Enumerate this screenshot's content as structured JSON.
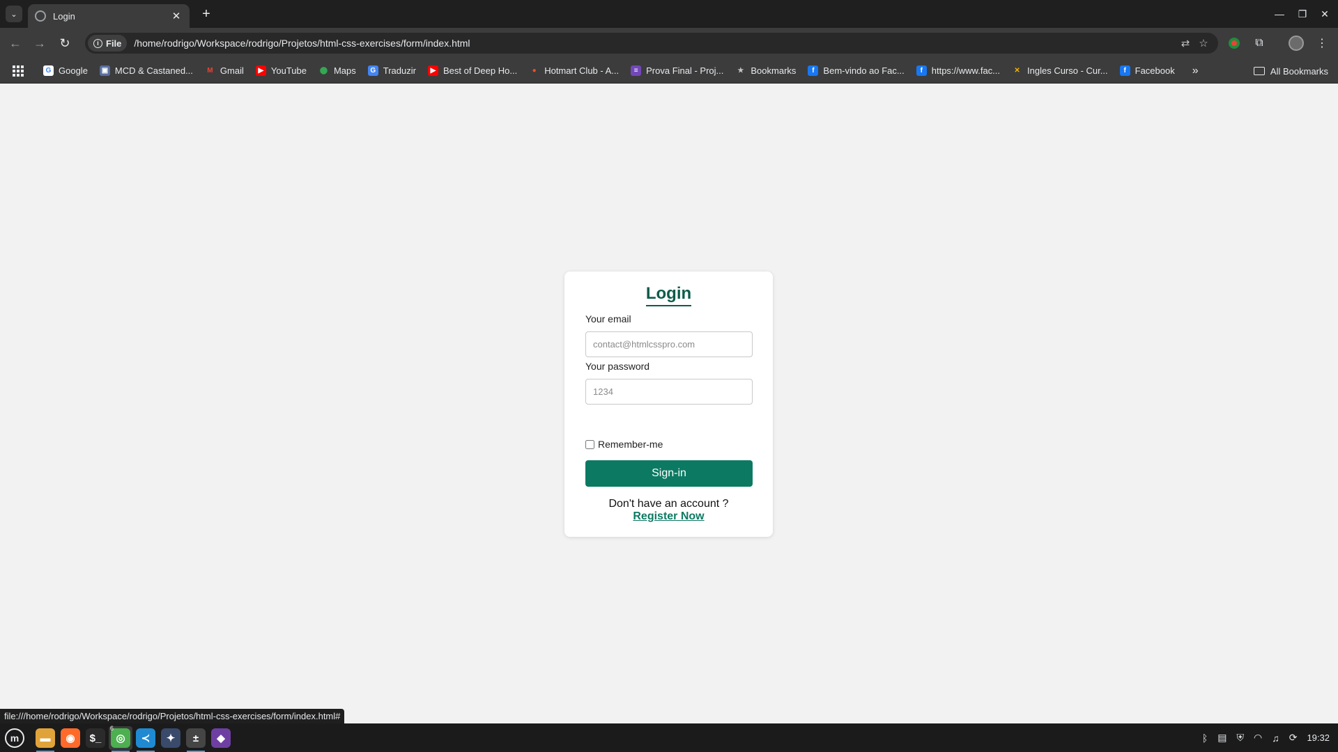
{
  "browser": {
    "tab_title": "Login",
    "url_chip": "File",
    "url": "/home/rodrigo/Workspace/rodrigo/Projetos/html-css-exercises/form/index.html",
    "status_url": "file:///home/rodrigo/Workspace/rodrigo/Projetos/html-css-exercises/form/index.html#"
  },
  "bookmarks": {
    "items": [
      {
        "label": "Google",
        "icon": "google-icon",
        "color": "#ffffff",
        "glyph": "G",
        "glyph_color": "#4285f4"
      },
      {
        "label": "MCD & Castaned...",
        "icon": "mcd-icon",
        "color": "#5a6f9e",
        "glyph": "▣",
        "glyph_color": "#ffffff"
      },
      {
        "label": "Gmail",
        "icon": "gmail-icon",
        "color": "#3c3c3c",
        "glyph": "M",
        "glyph_color": "#ea4335"
      },
      {
        "label": "YouTube",
        "icon": "youtube-icon",
        "color": "#ff0000",
        "glyph": "▶",
        "glyph_color": "#ffffff"
      },
      {
        "label": "Maps",
        "icon": "maps-icon",
        "color": "#3c3c3c",
        "glyph": "⬤",
        "glyph_color": "#34a853"
      },
      {
        "label": "Traduzir",
        "icon": "translate-icon",
        "color": "#4285f4",
        "glyph": "G",
        "glyph_color": "#ffffff"
      },
      {
        "label": "Best of Deep Ho...",
        "icon": "youtube-icon",
        "color": "#ff0000",
        "glyph": "▶",
        "glyph_color": "#ffffff"
      },
      {
        "label": "Hotmart Club - A...",
        "icon": "hotmart-icon",
        "color": "#3c3c3c",
        "glyph": "●",
        "glyph_color": "#f04e23"
      },
      {
        "label": "Prova Final - Proj...",
        "icon": "forms-icon",
        "color": "#7248b9",
        "glyph": "≡",
        "glyph_color": "#ffffff"
      },
      {
        "label": "Bookmarks",
        "icon": "star-icon",
        "color": "#3c3c3c",
        "glyph": "★",
        "glyph_color": "#c4c7c5"
      },
      {
        "label": "Bem-vindo ao Fac...",
        "icon": "facebook-icon",
        "color": "#1877f2",
        "glyph": "f",
        "glyph_color": "#ffffff"
      },
      {
        "label": "https://www.fac...",
        "icon": "facebook-icon",
        "color": "#1877f2",
        "glyph": "f",
        "glyph_color": "#ffffff"
      },
      {
        "label": "Ingles Curso - Cur...",
        "icon": "course-icon",
        "color": "#3c3c3c",
        "glyph": "✕",
        "glyph_color": "#f4b400"
      },
      {
        "label": "Facebook",
        "icon": "facebook-icon",
        "color": "#1877f2",
        "glyph": "f",
        "glyph_color": "#ffffff"
      }
    ],
    "overflow": "»",
    "all_bookmarks": "All Bookmarks"
  },
  "login": {
    "title": "Login",
    "email_label": "Your email",
    "email_placeholder": "contact@htmlcsspro.com",
    "password_label": "Your password",
    "password_placeholder": "1234",
    "remember_label": "Remember-me",
    "remember_checked": false,
    "signin_label": "Sign-in",
    "register_prompt": "Don't have an account ?",
    "register_link": "Register Now"
  },
  "colors": {
    "accent": "#0c7a63",
    "title": "#0b5c4a",
    "page_bg": "#f2f2f2"
  },
  "taskbar": {
    "apps": [
      {
        "name": "files-app",
        "color": "#e0a33a",
        "glyph": "▬"
      },
      {
        "name": "firefox-app",
        "color": "#ff6a2b",
        "glyph": "◉"
      },
      {
        "name": "terminal-app",
        "color": "#2b2b2b",
        "glyph": "$_"
      },
      {
        "name": "chrome-app",
        "color": "#4caf50",
        "glyph": "◎",
        "badge": "6"
      },
      {
        "name": "vscode-app",
        "color": "#1f8ad2",
        "glyph": "≺"
      },
      {
        "name": "launcher-app",
        "color": "#394a6b",
        "glyph": "✦"
      },
      {
        "name": "calculator-app",
        "color": "#454545",
        "glyph": "±"
      },
      {
        "name": "github-app",
        "color": "#6e3fa3",
        "glyph": "◆"
      }
    ],
    "clock": "19:32"
  }
}
